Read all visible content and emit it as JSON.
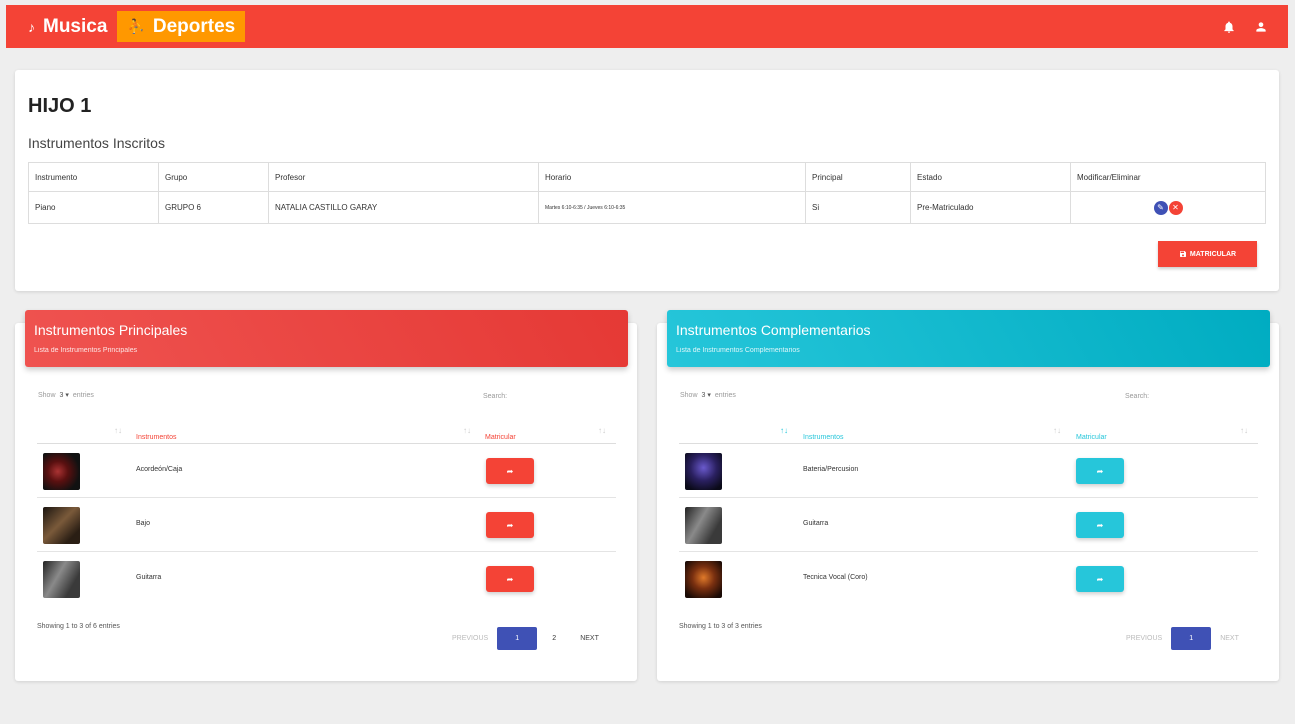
{
  "nav": {
    "musica_label": "Musica",
    "deportes_label": "Deportes",
    "primary_color": "#f44336",
    "active_color": "#ff9800"
  },
  "student": {
    "name": "HIJO 1",
    "section_title": "Instrumentos Inscritos"
  },
  "enrolled_table": {
    "headers": [
      "Instrumento",
      "Grupo",
      "Profesor",
      "Horario",
      "Principal",
      "Estado",
      "Modificar/Eliminar"
    ],
    "rows": [
      {
        "instrumento": "Piano",
        "grupo": "GRUPO 6",
        "profesor": "NATALIA CASTILLO GARAY",
        "horario": "Martes 6:10-6:35 / Jueves 6:10-6:35",
        "principal": "Si",
        "estado": "Pre-Matriculado"
      }
    ]
  },
  "matricular_label": "MATRICULAR",
  "principales": {
    "title": "Instrumentos Principales",
    "subtitle": "Lista de Instrumentos Principales",
    "color": "#f44336",
    "show_label": "Show",
    "length_value": "3",
    "entries_label": "entries",
    "search_label": "Search:",
    "col_instrumentos": "Instrumentos",
    "col_matricular": "Matricular",
    "rows": [
      {
        "name": "Acordeón/Caja"
      },
      {
        "name": "Bajo"
      },
      {
        "name": "Guitarra"
      }
    ],
    "info": "Showing 1 to 3 of 6 entries",
    "previous": "PREVIOUS",
    "pages": [
      "1",
      "2"
    ],
    "next": "NEXT"
  },
  "complementarios": {
    "title": "Instrumentos Complementarios",
    "subtitle": "Lista de Instrumentos Complementarios",
    "color": "#26c6da",
    "show_label": "Show",
    "length_value": "3",
    "entries_label": "entries",
    "search_label": "Search:",
    "col_instrumentos": "Instrumentos",
    "col_matricular": "Matricular",
    "rows": [
      {
        "name": "Bateria/Percusion"
      },
      {
        "name": "Guitarra"
      },
      {
        "name": "Tecnica Vocal (Coro)"
      }
    ],
    "info": "Showing 1 to 3 of 3 entries",
    "previous": "PREVIOUS",
    "pages": [
      "1"
    ],
    "next": "NEXT"
  }
}
